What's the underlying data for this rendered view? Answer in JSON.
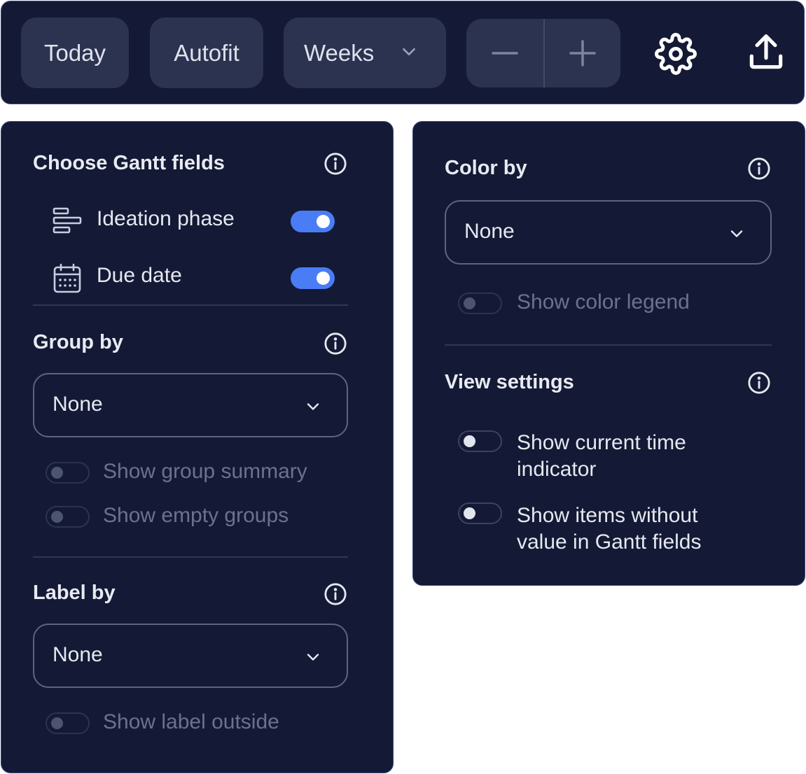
{
  "toolbar": {
    "today_label": "Today",
    "autofit_label": "Autofit",
    "timescale_value": "Weeks",
    "zoom_out_icon": "minus-icon",
    "zoom_in_icon": "plus-icon",
    "settings_icon": "gear-icon",
    "export_icon": "upload-icon"
  },
  "gantt_fields": {
    "title": "Choose Gantt fields",
    "fields": [
      {
        "label": "Ideation phase",
        "icon": "timeline-icon",
        "enabled": true
      },
      {
        "label": "Due date",
        "icon": "calendar-icon",
        "enabled": true
      }
    ]
  },
  "group_by": {
    "title": "Group by",
    "value": "None",
    "options": [
      {
        "label": "Show group summary",
        "on": false,
        "disabled": true
      },
      {
        "label": "Show empty groups",
        "on": false,
        "disabled": true
      }
    ]
  },
  "label_by": {
    "title": "Label by",
    "value": "None",
    "options": [
      {
        "label": "Show label outside",
        "on": false,
        "disabled": true
      }
    ]
  },
  "color_by": {
    "title": "Color by",
    "value": "None",
    "options": [
      {
        "label": "Show color legend",
        "on": false,
        "disabled": true
      }
    ]
  },
  "view_settings": {
    "title": "View settings",
    "options": [
      {
        "label_line1": "Show current time",
        "label_line2": "indicator",
        "on": false,
        "disabled": false
      },
      {
        "label_line1": "Show items without",
        "label_line2": "value in Gantt fields",
        "on": false,
        "disabled": false
      }
    ]
  },
  "colors": {
    "panel_bg": "#141a35",
    "panel_border": "#3a4a86",
    "button_bg": "#2c3350",
    "toggle_on": "#4a7cf6",
    "text": "#e6e8f0",
    "text_disabled": "#6b7290"
  }
}
